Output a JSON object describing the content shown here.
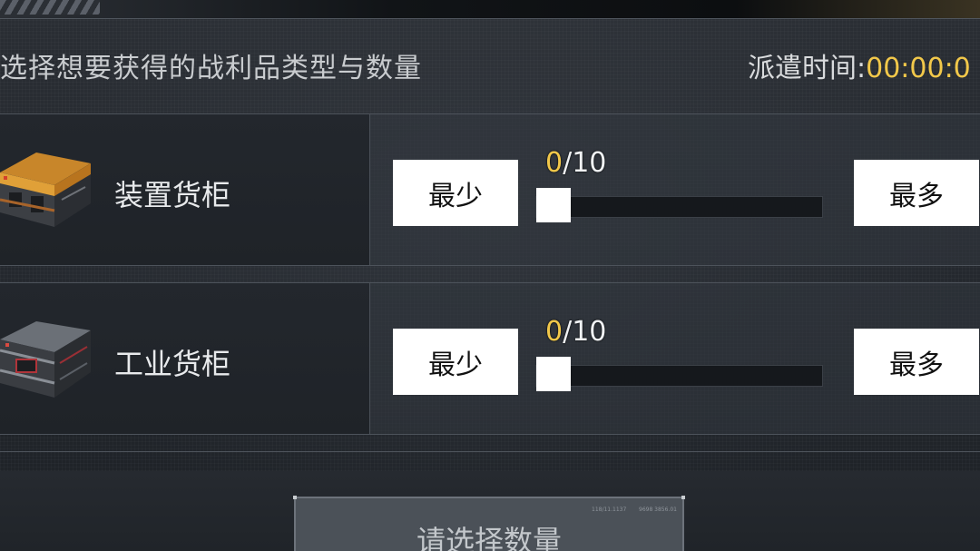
{
  "header": {
    "instruction": "选择想要获得的战利品类型与数量",
    "dispatch_label": "派遣时间:",
    "dispatch_time": "00:00:0"
  },
  "items": [
    {
      "name": "装置货柜",
      "icon": "orange-crate-icon",
      "min_label": "最少",
      "max_label": "最多",
      "current": "0",
      "max_suffix": "/10",
      "slider_fraction": 0
    },
    {
      "name": "工业货柜",
      "icon": "gray-crate-icon",
      "min_label": "最少",
      "max_label": "最多",
      "current": "0",
      "max_suffix": "/10",
      "slider_fraction": 0
    }
  ],
  "confirm": {
    "label": "请选择数量",
    "tiny_left": "118/11.1137",
    "tiny_right": "9698 3856.01"
  },
  "colors": {
    "accent_yellow": "#f2c84a",
    "button_bg": "#ffffff",
    "confirm_bg": "#4b5158"
  }
}
